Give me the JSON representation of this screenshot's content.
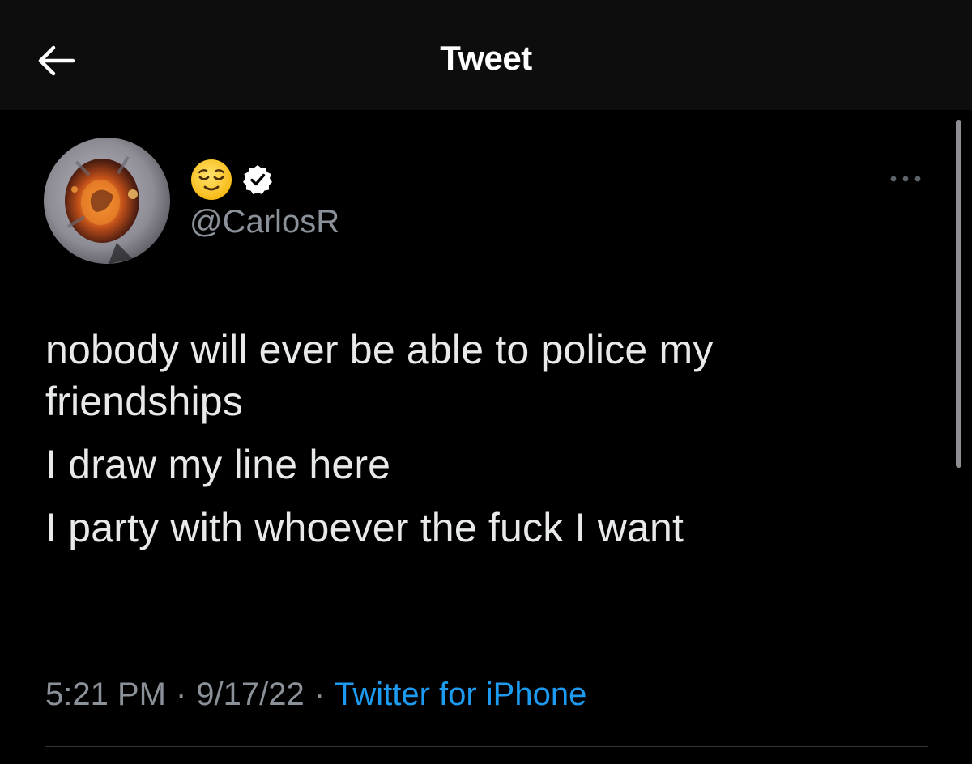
{
  "header": {
    "title": "Tweet",
    "back_icon": "arrow-left-icon",
    "background": "#0d0d0d"
  },
  "author": {
    "display_name_icon": "relieved-face-emoji",
    "verified_icon": "verified-badge-icon",
    "handle": "@CarlosR"
  },
  "tweet": {
    "paragraphs": [
      "nobody will ever be able to police my friendships",
      "I draw my line here",
      "I party with whoever the fuck I want"
    ]
  },
  "meta": {
    "time": "5:21 PM",
    "separator": "·",
    "date": "9/17/22",
    "source": "Twitter for iPhone"
  },
  "colors": {
    "background": "#000000",
    "text": "#e7e9ea",
    "secondary": "#8b9199",
    "link": "#1d9bf0"
  },
  "more_icon": "more-horizontal-icon"
}
